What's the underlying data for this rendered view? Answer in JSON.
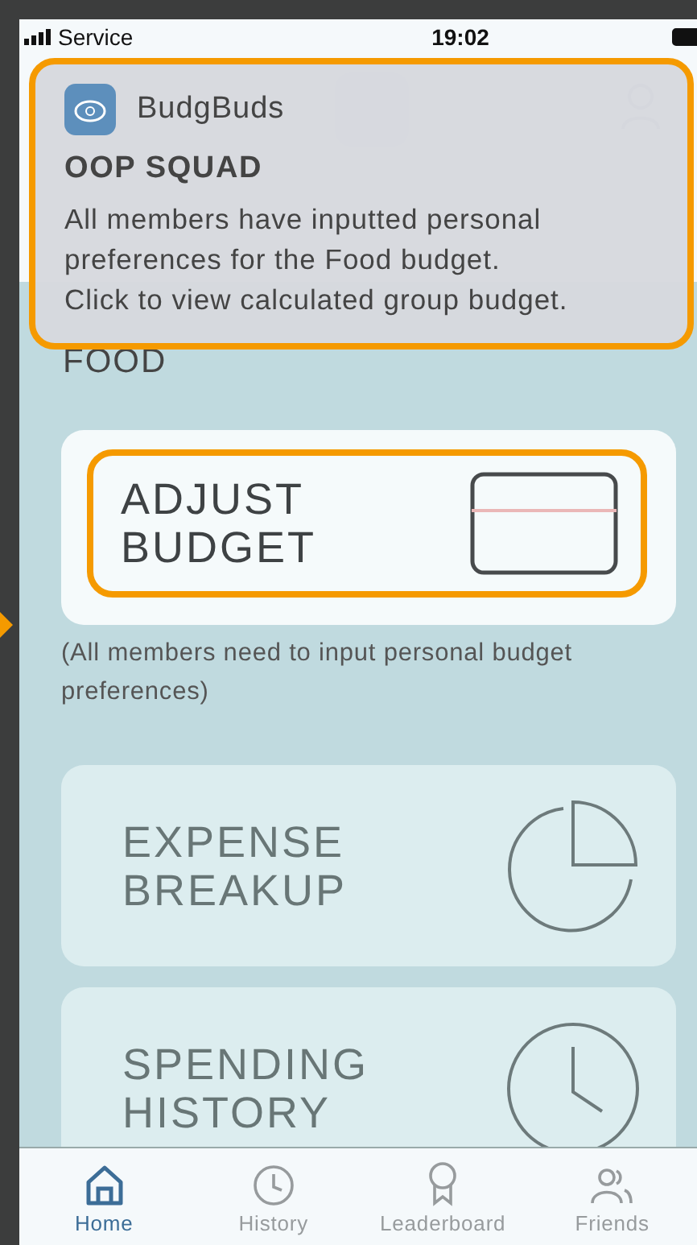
{
  "status_bar": {
    "carrier": "Service",
    "time": "19:02"
  },
  "notification": {
    "app_name": "BudgBuds",
    "title": "OOP SQUAD",
    "lines": [
      "All members have inputted personal preferences for the Food budget.",
      "Click to view calculated group budget."
    ],
    "highlighted": true
  },
  "section_title": "FOOD",
  "cards": [
    {
      "kind": "adjust",
      "label_lines": [
        "ADJUST",
        "BUDGET"
      ],
      "highlighted": true,
      "disabled": false,
      "note": "(All members need to input personal budget preferences)"
    },
    {
      "kind": "pie",
      "label_lines": [
        "EXPENSE",
        "BREAKUP"
      ],
      "highlighted": false,
      "disabled": true
    },
    {
      "kind": "clock",
      "label_lines": [
        "SPENDING",
        "HISTORY"
      ],
      "highlighted": false,
      "disabled": true
    }
  ],
  "tabs": [
    {
      "kind": "home",
      "label": "Home",
      "selected": true
    },
    {
      "kind": "history",
      "label": "History",
      "selected": false
    },
    {
      "kind": "leaderboard",
      "label": "Leaderboard",
      "selected": false
    },
    {
      "kind": "friends",
      "label": "Friends",
      "selected": false
    }
  ]
}
